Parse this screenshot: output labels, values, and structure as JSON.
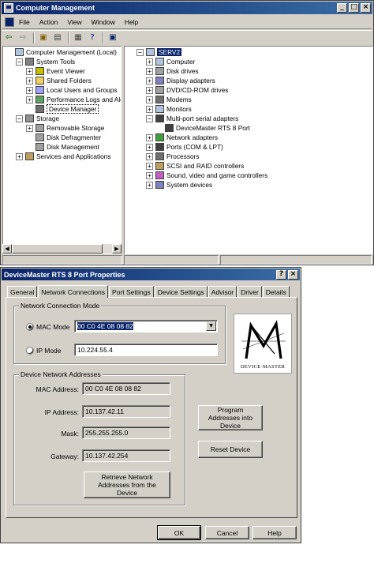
{
  "main_window": {
    "title": "Computer Management",
    "caption_buttons": {
      "minimize": "_",
      "maximize": "□",
      "close": "×"
    },
    "menu": [
      "File",
      "Action",
      "View",
      "Window",
      "Help"
    ],
    "toolbar_icons": [
      "back-arrow-icon",
      "forward-arrow-icon",
      "up-folder-icon",
      "show-tree-icon",
      "print-icon",
      "help-icon",
      "properties-icon"
    ],
    "left_tree": [
      {
        "label": "Computer Management (Local)",
        "level": 0,
        "expander": "",
        "icon": "computer-management-icon"
      },
      {
        "label": "System Tools",
        "level": 1,
        "expander": "−",
        "icon": "system-tools-icon"
      },
      {
        "label": "Event Viewer",
        "level": 2,
        "expander": "+",
        "icon": "event-viewer-icon"
      },
      {
        "label": "Shared Folders",
        "level": 2,
        "expander": "+",
        "icon": "shared-folders-icon"
      },
      {
        "label": "Local Users and Groups",
        "level": 2,
        "expander": "+",
        "icon": "users-icon"
      },
      {
        "label": "Performance Logs and Alerts",
        "level": 2,
        "expander": "+",
        "icon": "performance-icon"
      },
      {
        "label": "Device Manager",
        "level": 2,
        "expander": "",
        "icon": "device-manager-icon"
      },
      {
        "label": "Storage",
        "level": 1,
        "expander": "−",
        "icon": "storage-icon"
      },
      {
        "label": "Removable Storage",
        "level": 2,
        "expander": "+",
        "icon": "removable-storage-icon"
      },
      {
        "label": "Disk Defragmenter",
        "level": 2,
        "expander": "",
        "icon": "defrag-icon"
      },
      {
        "label": "Disk Management",
        "level": 2,
        "expander": "",
        "icon": "disk-management-icon"
      },
      {
        "label": "Services and Applications",
        "level": 1,
        "expander": "+",
        "icon": "services-icon"
      }
    ],
    "right_tree": [
      {
        "label": "SERV2",
        "level": 0,
        "expander": "−",
        "icon": "computer-icon"
      },
      {
        "label": "Computer",
        "level": 1,
        "expander": "+",
        "icon": "computer-icon"
      },
      {
        "label": "Disk drives",
        "level": 1,
        "expander": "+",
        "icon": "disk-drive-icon"
      },
      {
        "label": "Display adapters",
        "level": 1,
        "expander": "+",
        "icon": "display-adapter-icon"
      },
      {
        "label": "DVD/CD-ROM drives",
        "level": 1,
        "expander": "+",
        "icon": "cdrom-icon"
      },
      {
        "label": "Modems",
        "level": 1,
        "expander": "+",
        "icon": "modem-icon"
      },
      {
        "label": "Monitors",
        "level": 1,
        "expander": "+",
        "icon": "monitor-icon"
      },
      {
        "label": "Multi-port serial adapters",
        "level": 1,
        "expander": "−",
        "icon": "serial-adapter-icon"
      },
      {
        "label": "DeviceMaster RTS 8 Port",
        "level": 2,
        "expander": "",
        "icon": "serial-port-icon"
      },
      {
        "label": "Network adapters",
        "level": 1,
        "expander": "+",
        "icon": "network-adapter-icon"
      },
      {
        "label": "Ports (COM & LPT)",
        "level": 1,
        "expander": "+",
        "icon": "port-icon"
      },
      {
        "label": "Processors",
        "level": 1,
        "expander": "+",
        "icon": "processor-icon"
      },
      {
        "label": "SCSI and RAID controllers",
        "level": 1,
        "expander": "+",
        "icon": "scsi-icon"
      },
      {
        "label": "Sound, video and game controllers",
        "level": 1,
        "expander": "+",
        "icon": "sound-icon"
      },
      {
        "label": "System devices",
        "level": 1,
        "expander": "+",
        "icon": "system-devices-icon"
      }
    ]
  },
  "dialog": {
    "title": "DeviceMaster RTS 8 Port Properties",
    "caption_buttons": {
      "help": "?",
      "close": "×"
    },
    "tabs": [
      "General",
      "Network Connections",
      "Port Settings",
      "Device Settings",
      "Advisor",
      "Driver",
      "Details"
    ],
    "active_tab": "Network Connections",
    "connection_mode": {
      "group_label": "Network Connection Mode",
      "mac_label": "MAC Mode",
      "mac_value": "00 C0 4E 08 08 82",
      "ip_label": "IP Mode",
      "ip_value": "10.224.55.4",
      "selected": "mac"
    },
    "addresses": {
      "group_label": "Device Network Addresses",
      "mac_address_label": "MAC Address:",
      "mac_address": "00 C0 4E 08 08 82",
      "ip_address_label": "IP Address:",
      "ip_address": "10.137.42.11",
      "mask_label": "Mask:",
      "mask": "255.255.255.0",
      "gateway_label": "Gateway:",
      "gateway": "10.137.42.254"
    },
    "logo_text": "DEVICE·MASTER",
    "buttons": {
      "retrieve": "Retrieve Network Addresses from the Device",
      "program": "Program Addresses into Device",
      "reset": "Reset Device",
      "ok": "OK",
      "cancel": "Cancel",
      "help": "Help"
    }
  }
}
